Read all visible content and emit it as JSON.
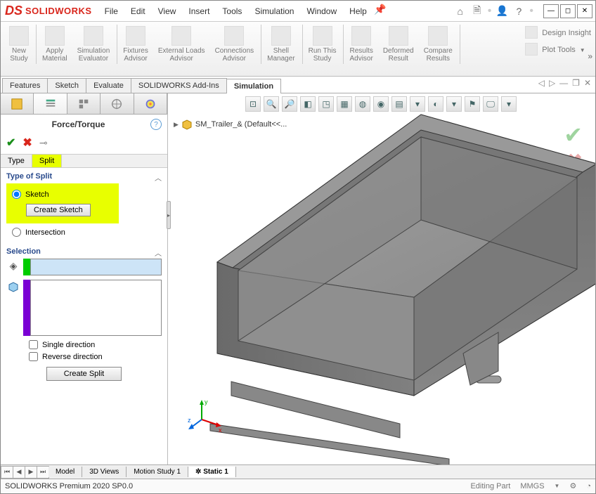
{
  "app": {
    "name": "SOLIDWORKS"
  },
  "menu": [
    "File",
    "Edit",
    "View",
    "Insert",
    "Tools",
    "Simulation",
    "Window",
    "Help"
  ],
  "ribbon": {
    "groups": [
      {
        "label": "New\nStudy"
      },
      {
        "label": "Apply\nMaterial"
      },
      {
        "label": "Simulation\nEvaluator"
      },
      {
        "label": "Fixtures\nAdvisor"
      },
      {
        "label": "External Loads\nAdvisor"
      },
      {
        "label": "Connections\nAdvisor"
      },
      {
        "label": "Shell\nManager"
      },
      {
        "label": "Run This\nStudy"
      },
      {
        "label": "Results\nAdvisor"
      },
      {
        "label": "Deformed\nResult"
      },
      {
        "label": "Compare\nResults"
      }
    ],
    "right": [
      "Design Insight",
      "Plot Tools"
    ]
  },
  "tabs": {
    "items": [
      "Features",
      "Sketch",
      "Evaluate",
      "SOLIDWORKS Add-Ins",
      "Simulation"
    ],
    "active": 4
  },
  "panel": {
    "title": "Force/Torque",
    "subtabs": {
      "items": [
        "Type",
        "Split"
      ],
      "active": 1
    },
    "split": {
      "header": "Type of Split",
      "sketch_radio": "Sketch",
      "create_sketch": "Create Sketch",
      "intersection_radio": "Intersection"
    },
    "selection": {
      "header": "Selection",
      "single_direction": "Single direction",
      "reverse_direction": "Reverse direction",
      "create_split": "Create Split"
    }
  },
  "viewport": {
    "tree_item": "SM_Trailer_& (Default<<...",
    "triad": {
      "x": "x",
      "y": "y",
      "z": "z"
    }
  },
  "bottom_tabs": {
    "items": [
      "Model",
      "3D Views",
      "Motion Study 1",
      "Static 1"
    ],
    "active": 3
  },
  "status": {
    "left": "SOLIDWORKS Premium 2020 SP0.0",
    "center": "Editing Part",
    "units": "MMGS"
  }
}
